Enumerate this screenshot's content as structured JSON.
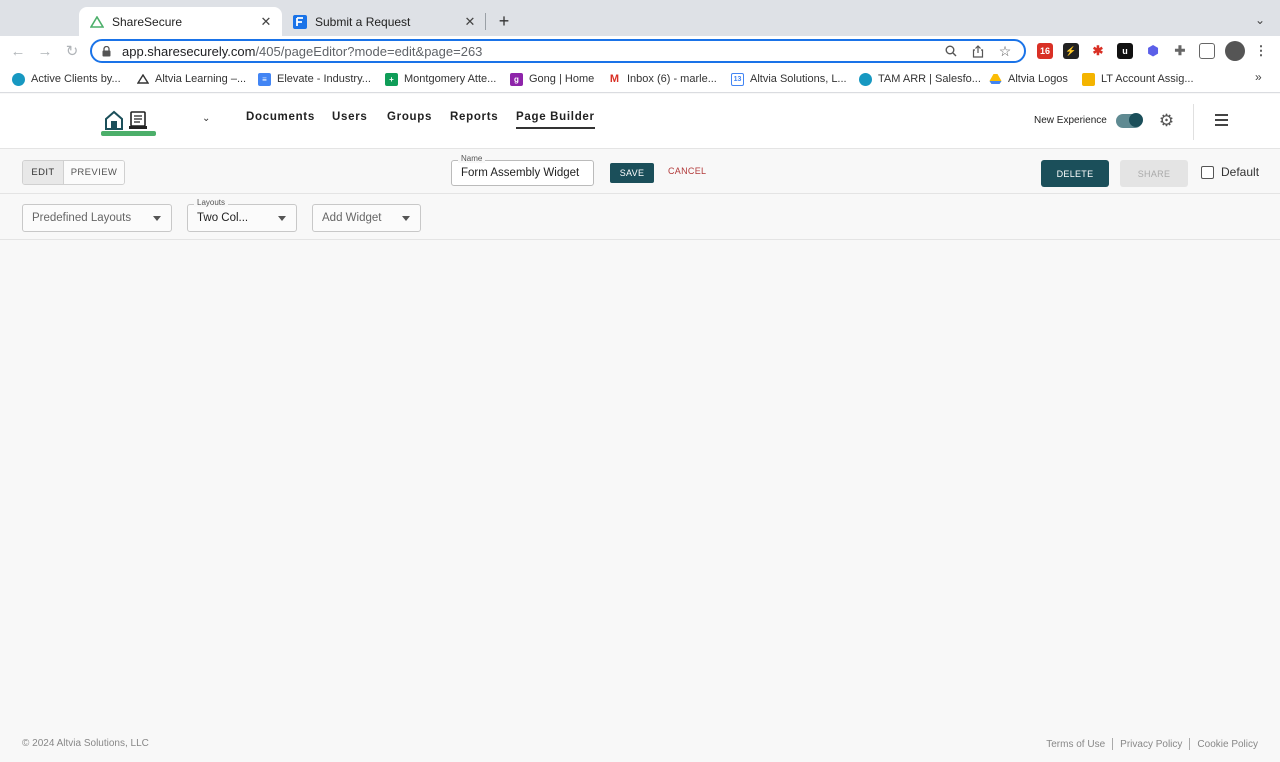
{
  "browser": {
    "tabs": [
      {
        "title": "ShareSecure",
        "active": true,
        "icon": "sharesecure-icon"
      },
      {
        "title": "Submit a Request",
        "active": false,
        "icon": "formassembly-icon"
      }
    ],
    "url": {
      "host": "app.sharesecurely.com",
      "path": "/405/pageEditor?mode=edit&page=263"
    },
    "extensions": [
      {
        "name": "mail-badge-ext",
        "badge": "16"
      }
    ],
    "bookmarks": [
      {
        "label": "Active Clients by...",
        "icon": "salesforce-icon",
        "color": "#1798c1"
      },
      {
        "label": "Altvia Learning –...",
        "icon": "altvia-icon",
        "color": "#333333"
      },
      {
        "label": "Elevate - Industry...",
        "icon": "docs-icon",
        "color": "#4285f4"
      },
      {
        "label": "Montgomery Atte...",
        "icon": "sheets-icon",
        "color": "#0f9d58"
      },
      {
        "label": "Gong | Home",
        "icon": "gong-icon",
        "color": "#8e24aa"
      },
      {
        "label": "Inbox (6) - marle...",
        "icon": "gmail-icon",
        "color": "#d93025"
      },
      {
        "label": "Altvia Solutions, L...",
        "icon": "calendar-icon",
        "color": "#4285f4"
      },
      {
        "label": "TAM ARR | Salesfo...",
        "icon": "salesforce-icon",
        "color": "#1798c1"
      },
      {
        "label": "Altvia Logos",
        "icon": "drive-icon",
        "color": "#fbbc04"
      },
      {
        "label": "LT Account Assig...",
        "icon": "slides-icon",
        "color": "#f4b400"
      }
    ]
  },
  "app": {
    "nav": [
      "Documents",
      "Users",
      "Groups",
      "Reports",
      "Page Builder"
    ],
    "active_nav": "Page Builder",
    "new_experience_label": "New Experience",
    "new_experience_on": true
  },
  "editor": {
    "edit_label": "EDIT",
    "preview_label": "PREVIEW",
    "name_label": "Name",
    "name_value": "Form Assembly Widget",
    "save_label": "SAVE",
    "cancel_label": "CANCEL",
    "delete_label": "DELETE",
    "share_label": "SHARE",
    "default_label": "Default",
    "default_checked": false
  },
  "selects": {
    "predefined_layouts": "Predefined Layouts",
    "layouts_label": "Layouts",
    "layouts_value": "Two Col...",
    "add_widget": "Add Widget"
  },
  "footer": {
    "copyright": "© 2024 Altvia Solutions, LLC",
    "links": [
      "Terms of Use",
      "Privacy Policy",
      "Cookie Policy"
    ]
  },
  "colors": {
    "primary": "#1b4f5a",
    "cancel": "#b23a3a",
    "logo_accent": "#4caf6a"
  }
}
